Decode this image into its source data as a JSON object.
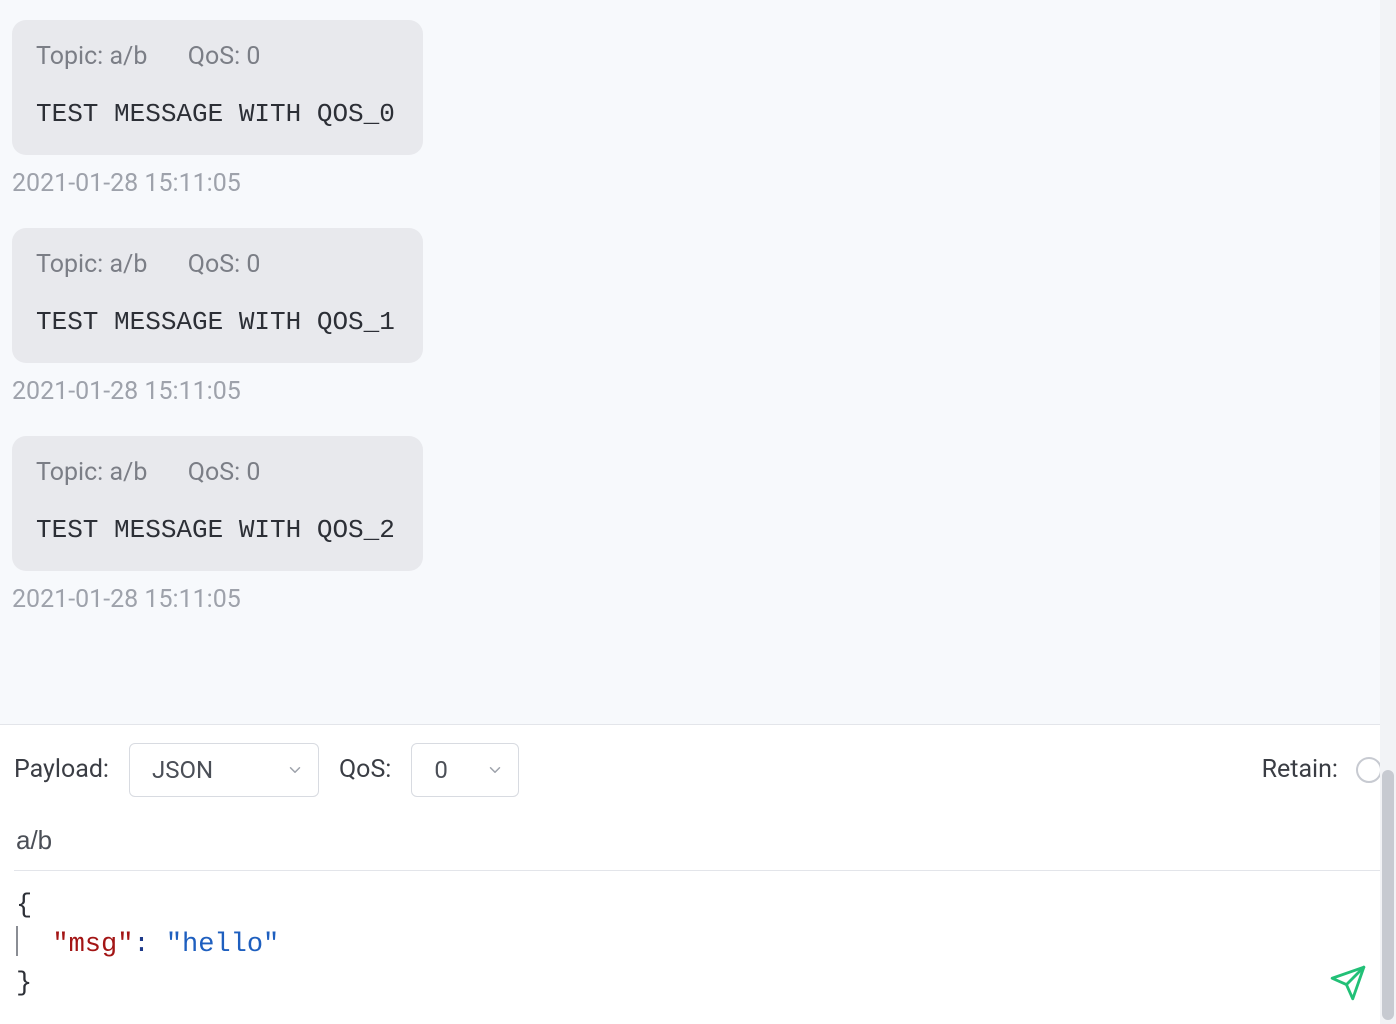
{
  "messages": [
    {
      "topic_label": "Topic:",
      "topic_value": "a/b",
      "qos_label": "QoS:",
      "qos_value": "0",
      "body": "TEST MESSAGE WITH QOS_0",
      "timestamp": "2021-01-28 15:11:05"
    },
    {
      "topic_label": "Topic:",
      "topic_value": "a/b",
      "qos_label": "QoS:",
      "qos_value": "0",
      "body": "TEST MESSAGE WITH QOS_1",
      "timestamp": "2021-01-28 15:11:05"
    },
    {
      "topic_label": "Topic:",
      "topic_value": "a/b",
      "qos_label": "QoS:",
      "qos_value": "0",
      "body": "TEST MESSAGE WITH QOS_2",
      "timestamp": "2021-01-28 15:11:05"
    }
  ],
  "composer": {
    "payload_label": "Payload:",
    "payload_value": "JSON",
    "qos_label": "QoS:",
    "qos_value": "0",
    "retain_label": "Retain:",
    "retain_checked": false,
    "topic_value": "a/b",
    "payload_json": {
      "open_brace": "{",
      "indent": "  ",
      "key": "\"msg\"",
      "colon": ": ",
      "value": "\"hello\"",
      "close_brace": "}"
    }
  }
}
